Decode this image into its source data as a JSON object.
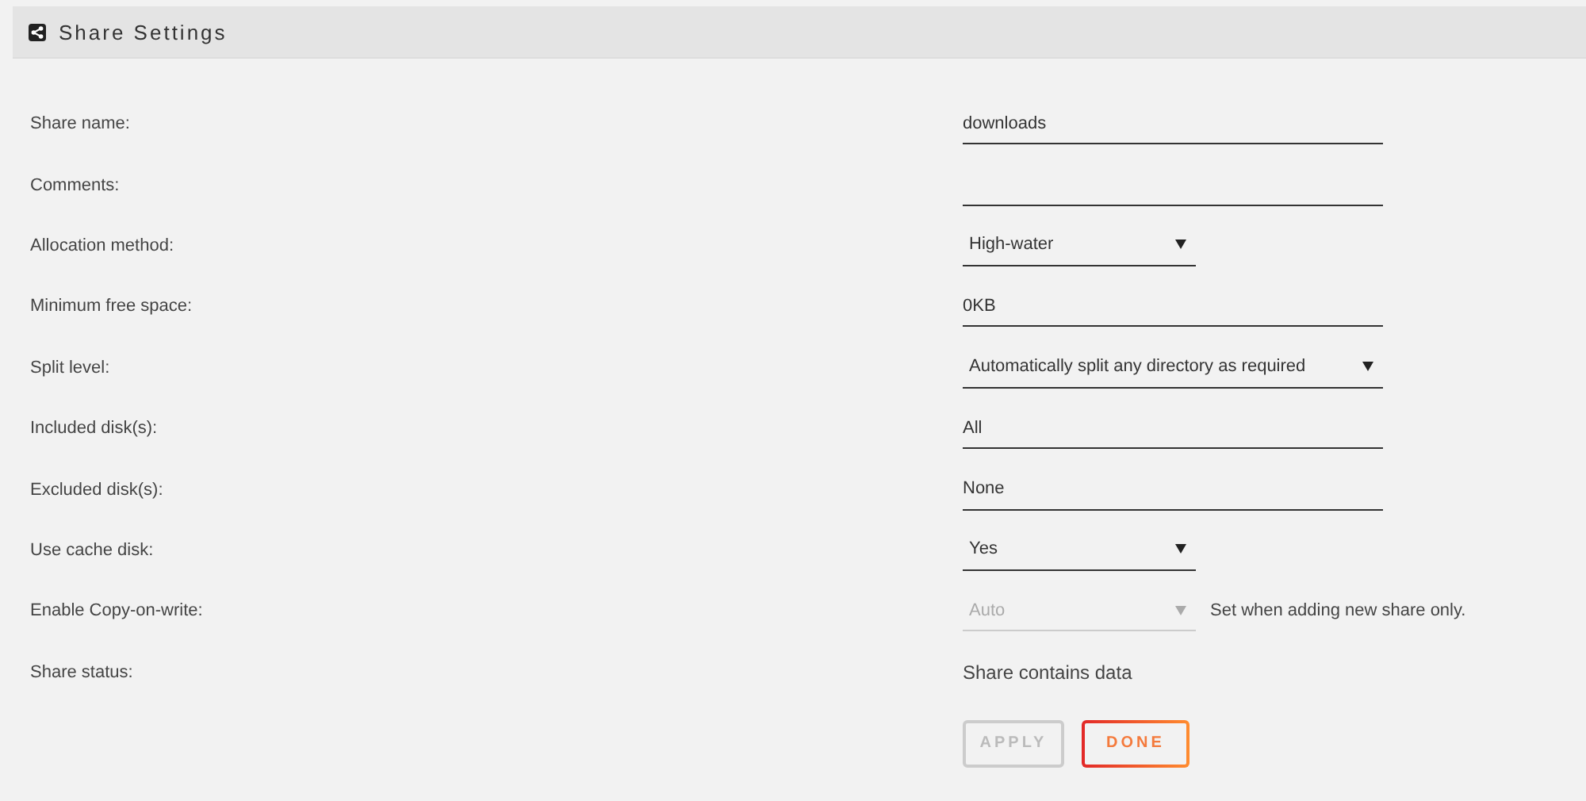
{
  "header": {
    "title": "Share Settings"
  },
  "rows": [
    {
      "label": "Share name:",
      "kind": "input",
      "value": "downloads"
    },
    {
      "label": "Comments:",
      "kind": "input"
    },
    {
      "label": "Allocation method:",
      "kind": "select",
      "value": "High-water",
      "disabled": false
    },
    {
      "label": "Minimum free space:",
      "kind": "input",
      "value": "0KB"
    },
    {
      "label": "Split level:",
      "kind": "long-select",
      "value": "Automatically split any directory as required",
      "disabled": false
    },
    {
      "label": "Included disk(s):",
      "kind": "input",
      "value": "All"
    },
    {
      "label": "Excluded disk(s):",
      "kind": "input",
      "value": "None"
    },
    {
      "label": "Use cache disk:",
      "kind": "select",
      "value": "Yes",
      "disabled": false
    },
    {
      "label": "Enable Copy-on-write:",
      "kind": "select",
      "value": "Auto",
      "disabled": true,
      "note": "Set when adding new share only."
    },
    {
      "label": "Share status:",
      "kind": "text",
      "value": "Share contains data"
    }
  ],
  "buttons": [
    {
      "label": "APPLY",
      "disabled": true
    },
    {
      "label": "DONE",
      "disabled": false
    }
  ]
}
